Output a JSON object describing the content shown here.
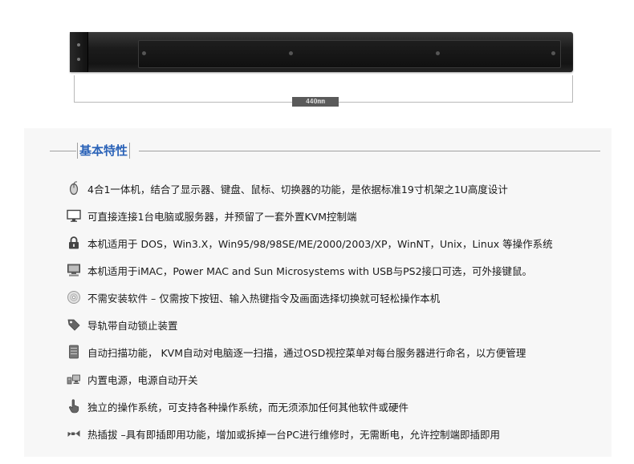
{
  "product": {
    "dimension_label": "440mm"
  },
  "section": {
    "title": "基本特性"
  },
  "features": [
    {
      "icon": "mouse-icon",
      "text": "4合1一体机，结合了显示器、键盘、鼠标、切换器的功能，是依据标准19寸机架之1U高度设计"
    },
    {
      "icon": "monitor-icon",
      "text": "可直接连接1台电脑或服务器，并预留了一套外置KVM控制端"
    },
    {
      "icon": "lock-icon",
      "text": "本机适用于 DOS，Win3.X，Win95/98/98SE/ME/2000/2003/XP，WinNT，Unix，Linux 等操作系统"
    },
    {
      "icon": "computer-icon",
      "text": "本机适用于iMAC，Power MAC and Sun Microsystems with USB与PS2接口可选，可外接键鼠。"
    },
    {
      "icon": "disc-icon",
      "text": "不需安装软件 – 仅需按下按钮、输入热键指令及画面选择切换就可轻松操作本机"
    },
    {
      "icon": "tag-icon",
      "text": "导轨带自动锁止装置"
    },
    {
      "icon": "server-icon",
      "text": "自动扫描功能， KVM自动对电脑逐一扫描，通过OSD视控菜单对每台服务器进行命名，以方便管理"
    },
    {
      "icon": "network-icon",
      "text": "内置电源，电源自动开关"
    },
    {
      "icon": "hand-icon",
      "text": "独立的操作系统，可支持各种操作系统，而无须添加任何其他软件或硬件"
    },
    {
      "icon": "plug-icon",
      "text": "热插拔 –具有即插即用功能，增加或拆掉一台PC进行维修时，无需断电，允许控制端即插即用"
    }
  ],
  "colors": {
    "title": "#2b63b8",
    "section_bg": "#f7f7f7",
    "icon": "#555555"
  }
}
